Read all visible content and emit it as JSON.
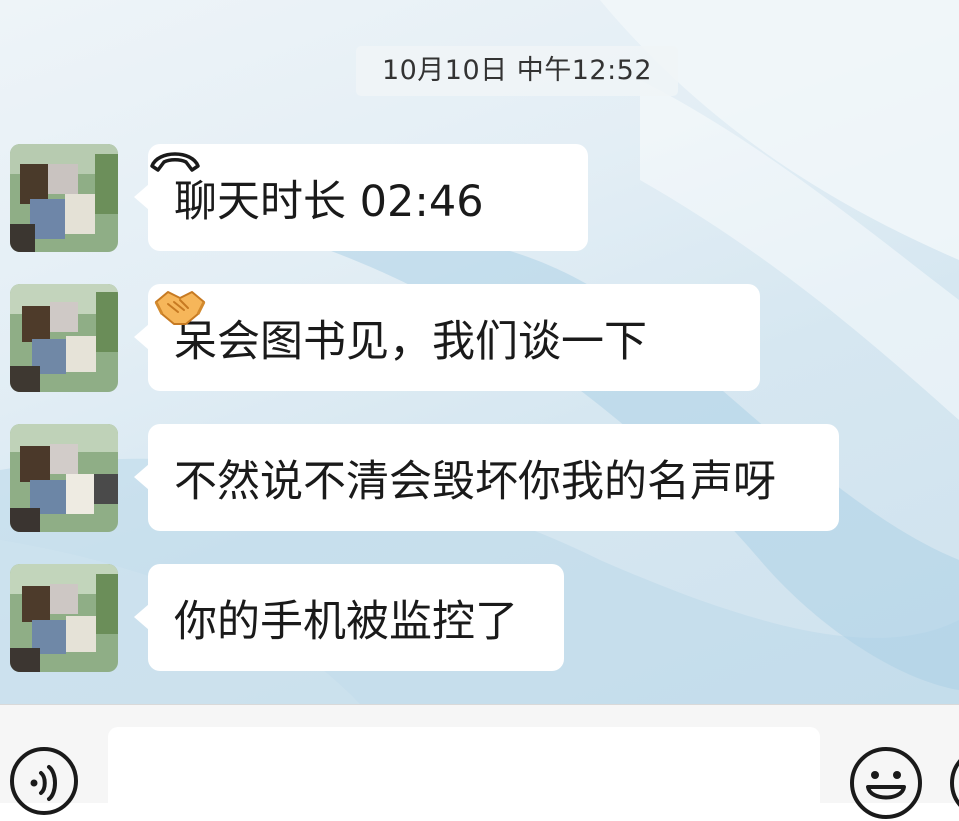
{
  "chat": {
    "timestamp": "10月10日 中午12:52",
    "messages": [
      {
        "type": "call",
        "text": "聊天时长 02:46",
        "icon": "phone-hangup-icon"
      },
      {
        "type": "text",
        "text": "呆会图书见，我们谈一下",
        "emoji": "handshake"
      },
      {
        "type": "text",
        "text": "不然说不清会毁坏你我的名声呀"
      },
      {
        "type": "text",
        "text": "你的手机被监控了"
      }
    ]
  },
  "input_bar": {
    "value": "",
    "voice_icon": "voice-icon",
    "emoji_icon": "smiley-icon"
  },
  "colors": {
    "bubble": "#ffffff",
    "text": "#1a1a1a",
    "input_bar_bg": "#f6f6f6"
  }
}
